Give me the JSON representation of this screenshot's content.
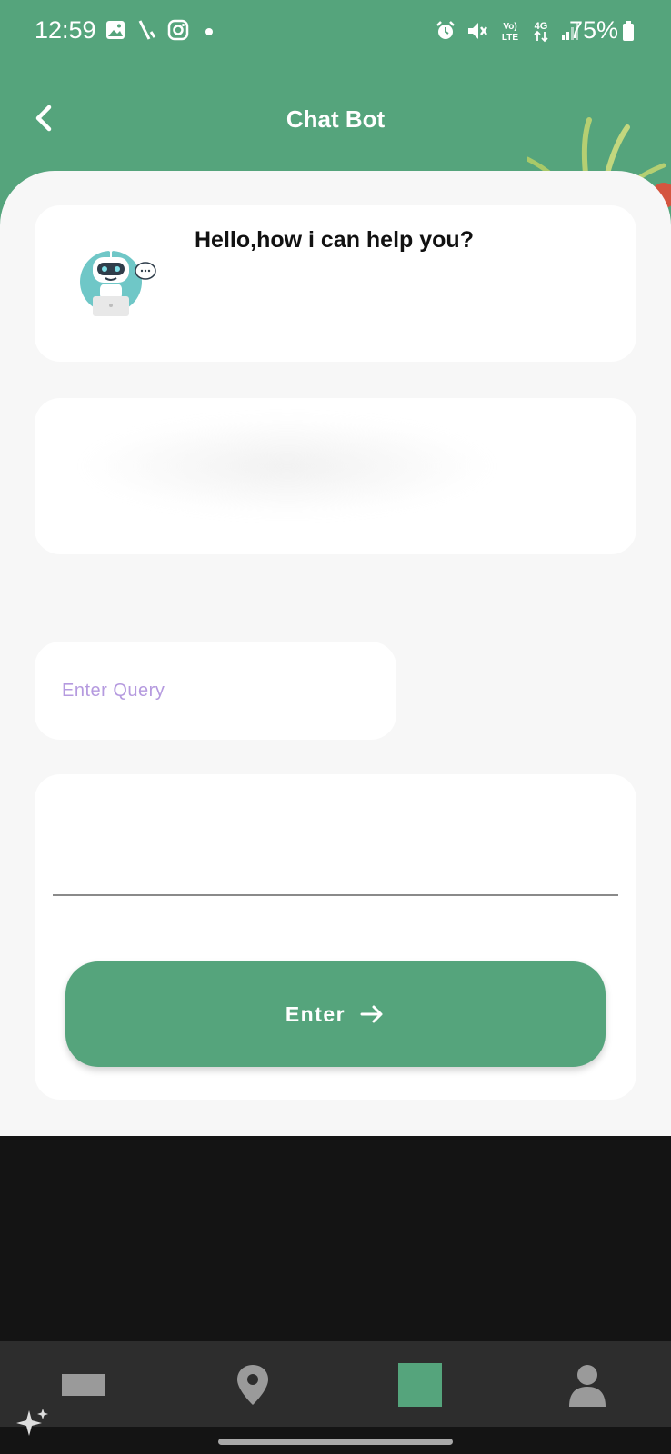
{
  "status_bar": {
    "time": "12:59",
    "battery": "75%",
    "left_icons": [
      "gallery-icon",
      "slash-icon",
      "instagram-icon",
      "dot-icon"
    ],
    "right_icons": [
      "alarm-icon",
      "mute-icon",
      "volte-icon",
      "4g-icon",
      "signal-icon"
    ]
  },
  "header": {
    "title": "Chat Bot",
    "back_icon": "chevron-left-icon"
  },
  "greeting": {
    "text": "Hello,how i can help you?"
  },
  "query": {
    "placeholder": "Enter Query",
    "value": ""
  },
  "action": {
    "enter_label": "Enter"
  },
  "bottom_nav": {
    "items": [
      "card-icon",
      "location-pin-icon",
      "active-square-icon",
      "profile-icon"
    ]
  },
  "colors": {
    "brand_green": "#55a47c",
    "placeholder_purple": "#b59adf",
    "sheet_bg": "#f7f7f7",
    "nav_bg": "#2d2d2d"
  }
}
